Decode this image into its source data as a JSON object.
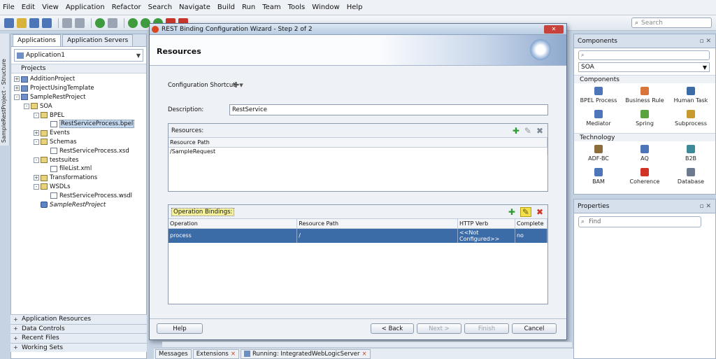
{
  "menu": [
    "File",
    "Edit",
    "View",
    "Application",
    "Refactor",
    "Search",
    "Navigate",
    "Build",
    "Run",
    "Team",
    "Tools",
    "Window",
    "Help"
  ],
  "search": {
    "placeholder": "Search"
  },
  "vertical_tab": "SampleRestProject - Structure",
  "left_panel": {
    "tabs": [
      "Applications",
      "Application Servers"
    ],
    "application": "Application1",
    "projects_header": "Projects",
    "tree": [
      {
        "label": "AdditionProject",
        "depth": 0,
        "exp": "+",
        "icon": "proj"
      },
      {
        "label": "ProjectUsingTemplate",
        "depth": 0,
        "exp": "+",
        "icon": "proj"
      },
      {
        "label": "SampleRestProject",
        "depth": 0,
        "exp": "-",
        "icon": "proj"
      },
      {
        "label": "SOA",
        "depth": 1,
        "exp": "-",
        "icon": "folder"
      },
      {
        "label": "BPEL",
        "depth": 2,
        "exp": "-",
        "icon": "folder"
      },
      {
        "label": "RestServiceProcess.bpel",
        "depth": 3,
        "exp": "",
        "icon": "file",
        "selected": true
      },
      {
        "label": "Events",
        "depth": 2,
        "exp": "+",
        "icon": "folder"
      },
      {
        "label": "Schemas",
        "depth": 2,
        "exp": "-",
        "icon": "folder"
      },
      {
        "label": "RestServiceProcess.xsd",
        "depth": 3,
        "exp": "",
        "icon": "file"
      },
      {
        "label": "testsuites",
        "depth": 2,
        "exp": "-",
        "icon": "folder"
      },
      {
        "label": "fileList.xml",
        "depth": 3,
        "exp": "",
        "icon": "file"
      },
      {
        "label": "Transformations",
        "depth": 2,
        "exp": "+",
        "icon": "folder"
      },
      {
        "label": "WSDLs",
        "depth": 2,
        "exp": "-",
        "icon": "folder"
      },
      {
        "label": "RestServiceProcess.wsdl",
        "depth": 3,
        "exp": "",
        "icon": "file"
      },
      {
        "label": "SampleRestProject",
        "depth": 2,
        "exp": "",
        "icon": "comp",
        "italic": true
      }
    ],
    "sections": [
      "Application Resources",
      "Data Controls",
      "Recent Files",
      "Working Sets"
    ]
  },
  "dialog": {
    "title": "REST Binding Configuration Wizard - Step 2 of 2",
    "banner_title": "Resources",
    "shortcut_label": "Configuration Shortcut:",
    "description_label": "Description:",
    "description_value": "RestService",
    "resources": {
      "header": "Resources:",
      "columns": [
        "Resource Path"
      ],
      "rows": [
        [
          "/SampleRequest"
        ]
      ]
    },
    "operations": {
      "header": "Operation Bindings:",
      "columns": [
        "Operation",
        "Resource Path",
        "HTTP Verb",
        "Complete"
      ],
      "rows": [
        [
          "process",
          "/",
          "<<Not Configured>>",
          "no"
        ]
      ]
    },
    "buttons": {
      "help": "Help",
      "back": "< Back",
      "next": "Next >",
      "finish": "Finish",
      "cancel": "Cancel"
    }
  },
  "components_panel": {
    "title": "Components",
    "category": "SOA",
    "groups": [
      {
        "name": "Components",
        "items": [
          {
            "label": "BPEL Process",
            "color": "#4d76b8"
          },
          {
            "label": "Business Rule",
            "color": "#d9743a"
          },
          {
            "label": "Human Task",
            "color": "#3c6ca8"
          },
          {
            "label": "Mediator",
            "color": "#4d76b8"
          },
          {
            "label": "Spring",
            "color": "#5aa33e"
          },
          {
            "label": "Subprocess",
            "color": "#c89a2e"
          }
        ]
      },
      {
        "name": "Technology",
        "items": [
          {
            "label": "ADF-BC",
            "color": "#8a6d3a"
          },
          {
            "label": "AQ",
            "color": "#4d76b8"
          },
          {
            "label": "B2B",
            "color": "#3e8a9b"
          },
          {
            "label": "BAM",
            "color": "#4d76b8"
          },
          {
            "label": "Coherence",
            "color": "#d03224"
          },
          {
            "label": "Database",
            "color": "#6c7a8e"
          }
        ]
      }
    ]
  },
  "properties_panel": {
    "title": "Properties",
    "find_placeholder": "Find"
  },
  "bottom_tabs": [
    "Messages",
    "Extensions",
    "Running: IntegratedWebLogicServer"
  ]
}
